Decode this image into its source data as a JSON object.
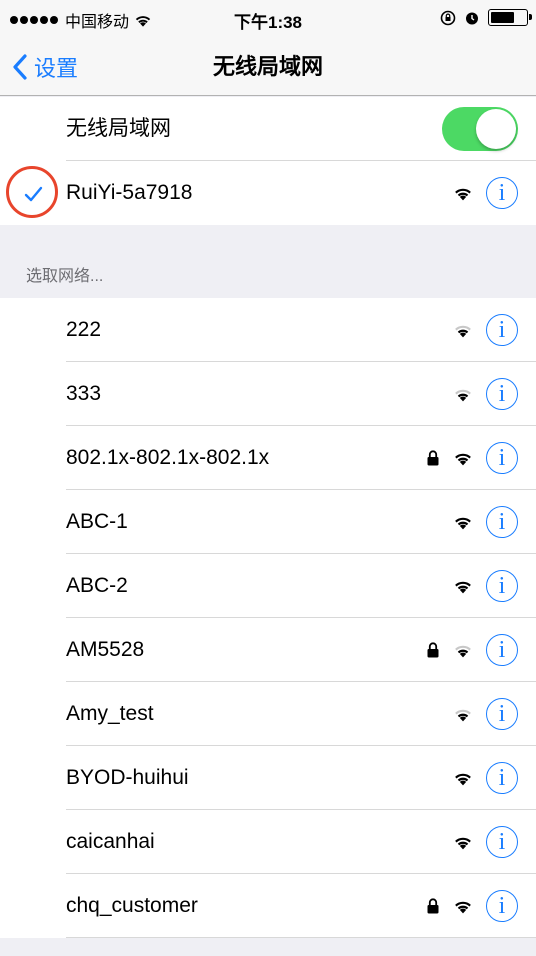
{
  "status_bar": {
    "carrier": "中国移动",
    "time": "下午1:38"
  },
  "nav": {
    "back_label": "设置",
    "title": "无线局域网"
  },
  "wifi_toggle": {
    "label": "无线局域网",
    "state": "on"
  },
  "connected_network": {
    "name": "RuiYi-5a7918",
    "locked": false
  },
  "choose_network_header": "选取网络...",
  "networks": [
    {
      "name": "222",
      "locked": false,
      "signal": "medium"
    },
    {
      "name": "333",
      "locked": false,
      "signal": "medium"
    },
    {
      "name": "802.1x-802.1x-802.1x",
      "locked": true,
      "signal": "full"
    },
    {
      "name": "ABC-1",
      "locked": false,
      "signal": "full"
    },
    {
      "name": "ABC-2",
      "locked": false,
      "signal": "full"
    },
    {
      "name": "AM5528",
      "locked": true,
      "signal": "medium"
    },
    {
      "name": "Amy_test",
      "locked": false,
      "signal": "medium"
    },
    {
      "name": "BYOD-huihui",
      "locked": false,
      "signal": "full"
    },
    {
      "name": "caicanhai",
      "locked": false,
      "signal": "full"
    },
    {
      "name": "chq_customer",
      "locked": true,
      "signal": "full"
    }
  ],
  "colors": {
    "accent": "#1a7dff",
    "toggle_on": "#4cd964",
    "highlight_circle": "#e8452c",
    "background": "#efeff4"
  },
  "icons": {
    "info": "i",
    "back": "chevron-left-icon",
    "wifi": "wifi-icon",
    "lock": "lock-icon",
    "check": "checkmark-icon"
  }
}
